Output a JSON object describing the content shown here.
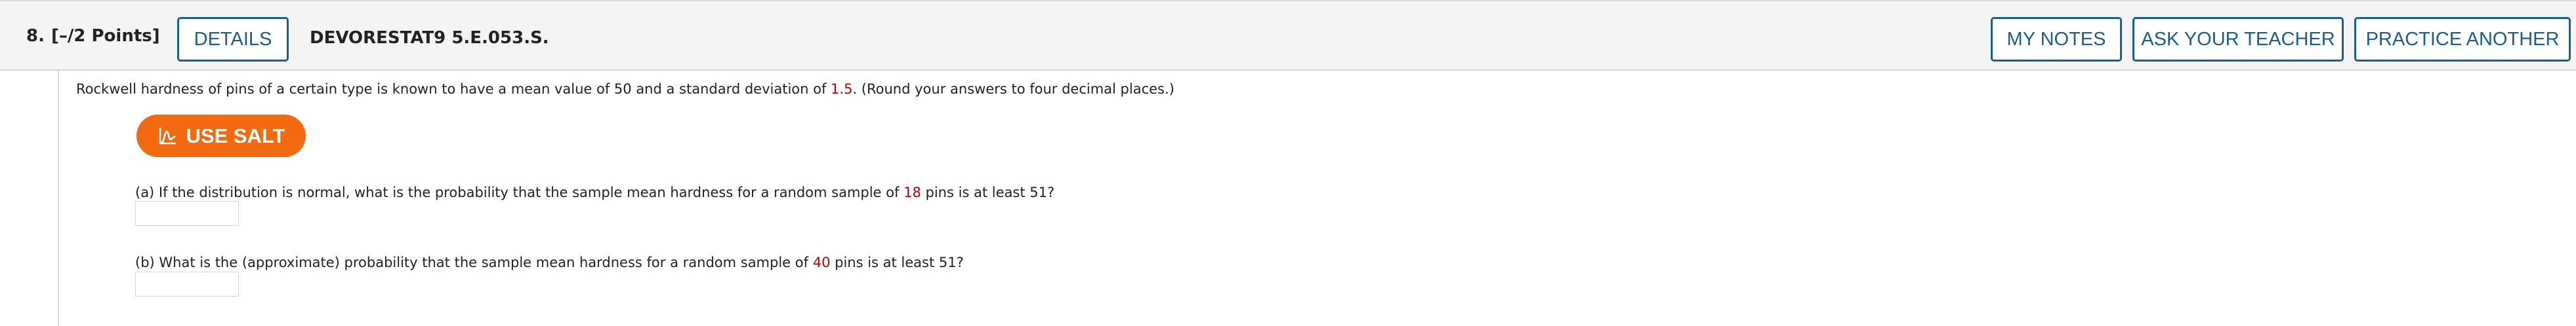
{
  "question": {
    "number": "8.",
    "points": "[–/2 Points]",
    "assignment_code": "DEVORESTAT9 5.E.053.S."
  },
  "header_buttons": {
    "details": "DETAILS",
    "my_notes": "MY NOTES",
    "ask_teacher": "ASK YOUR TEACHER",
    "practice_another": "PRACTICE ANOTHER"
  },
  "intro": {
    "before_sd": "Rockwell hardness of pins of a certain type is known to have a mean value of 50 and a standard deviation of ",
    "sd": "1.5",
    "after_sd": ". (Round your answers to four decimal places.)"
  },
  "salt": {
    "label": "USE SALT",
    "icon": "salt-chart-icon"
  },
  "part_a": {
    "before_n": "(a) If the distribution is normal, what is the probability that the sample mean hardness for a random sample of ",
    "n": "18",
    "after_n": " pins is at least 51?",
    "answer_value": ""
  },
  "part_b": {
    "before_n": "(b) What is the (approximate) probability that the sample mean hardness for a random sample of ",
    "n": "40",
    "after_n": " pins is at least 51?",
    "answer_value": ""
  },
  "colors": {
    "accent": "#1b5d8c",
    "salt_orange": "#f36a10",
    "highlight_red": "#c00000",
    "header_bg": "#f4f4f4"
  }
}
